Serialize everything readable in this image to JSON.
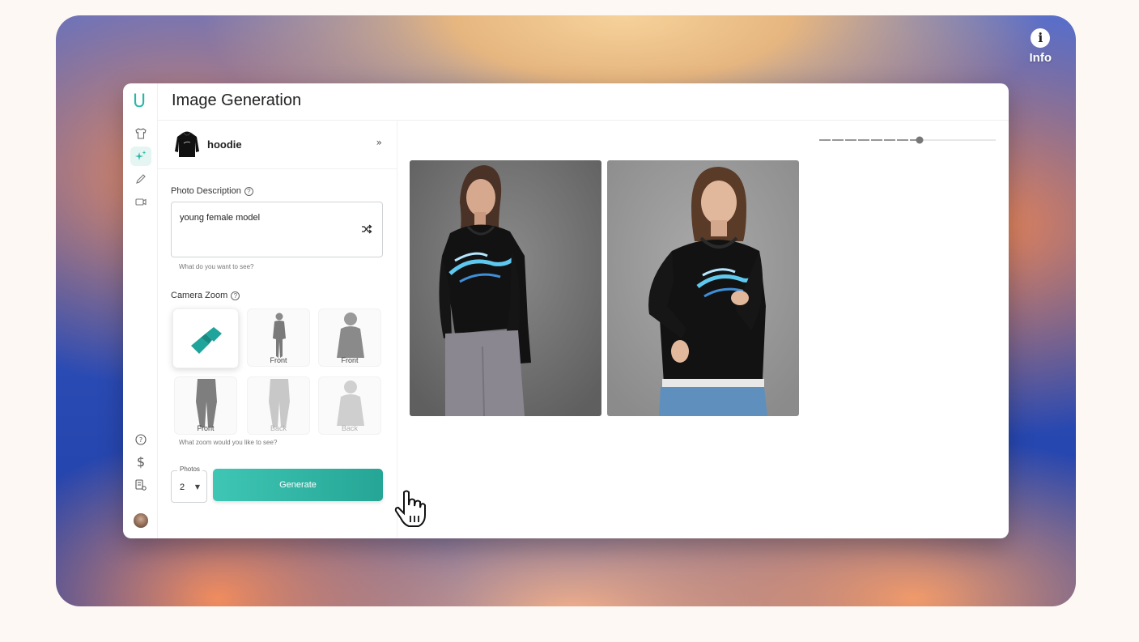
{
  "info": {
    "label": "Info",
    "icon": "info-icon"
  },
  "app": {
    "logo": "U",
    "title": "Image Generation"
  },
  "rail": {
    "top_icons": [
      "shirt-icon",
      "sparkles-icon",
      "pencil-icon",
      "camera-icon"
    ],
    "bottom_icons": [
      "help-icon",
      "dollar-icon",
      "settings-icon"
    ]
  },
  "product": {
    "name": "hoodie"
  },
  "description": {
    "label": "Photo Description",
    "value": "young female model",
    "hint": "What do you want to see?"
  },
  "zoom": {
    "label": "Camera Zoom",
    "hint": "What zoom would you like to see?",
    "options": [
      "",
      "Front",
      "Front",
      "Front",
      "Back",
      "Back"
    ]
  },
  "photos": {
    "label": "Photos",
    "value": "2"
  },
  "generate": {
    "label": "Generate"
  },
  "colors": {
    "accent": "#2ab7a9",
    "accent_dark": "#25a595"
  }
}
